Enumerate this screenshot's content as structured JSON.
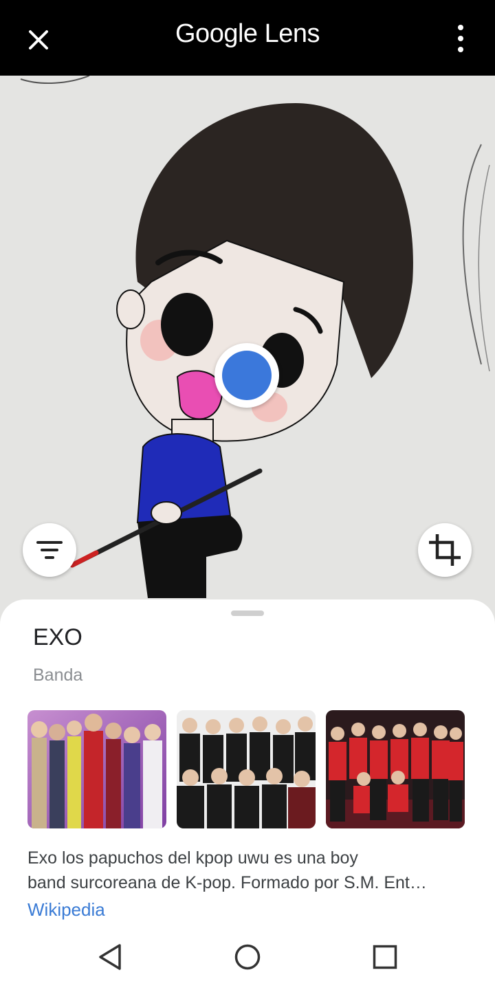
{
  "app": {
    "title": "Google Lens"
  },
  "result": {
    "title": "EXO",
    "subtitle": "Banda",
    "description": "Exo los papuchos del kpop uwu es una boy\nband surcoreana de K-pop. Formado por S.M. Ent…",
    "source": "Wikipedia"
  },
  "icons": {
    "close": "close-icon",
    "menu": "more-vert-icon",
    "filter": "filter-icon",
    "crop": "crop-icon",
    "back": "back-icon",
    "home": "home-icon",
    "recents": "recents-icon"
  },
  "colors": {
    "accent_blue": "#3b78db",
    "link_blue": "#3a7bd5",
    "topbar": "#000000"
  }
}
